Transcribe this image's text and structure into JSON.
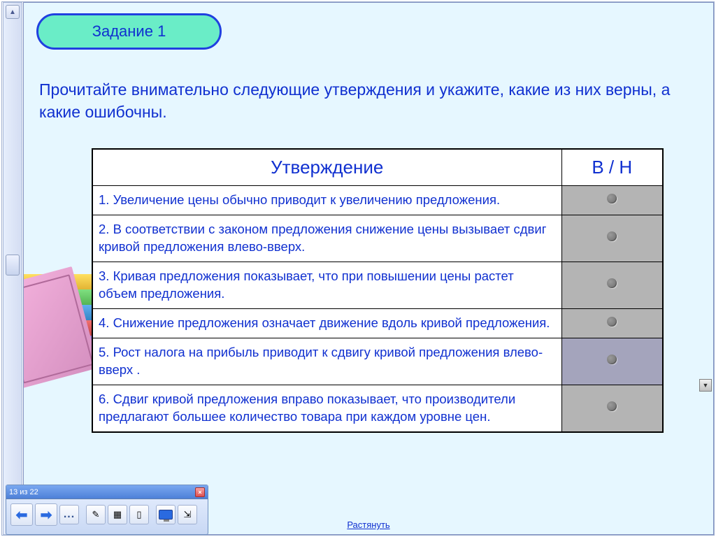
{
  "task": {
    "badge": "Задание 1",
    "instruction": "Прочитайте внимательно следующие утверждения и укажите, какие из них верны, а какие ошибочны."
  },
  "table": {
    "header_statement": "Утверждение",
    "header_vh": "В / Н",
    "rows": [
      {
        "text": "1. Увеличение цены обычно приводит к увеличению предложения."
      },
      {
        "text": "2. В соответствии с законом предложения снижение цены вызывает сдвиг кривой предложения влево-вверх."
      },
      {
        "text": "3. Кривая предложения показывает, что при повышении цены растет объем предложения."
      },
      {
        "text": "4. Снижение предложения означает движение вдоль кривой предложения."
      },
      {
        "text": "5. Рост налога на прибыль приводит к сдвигу кривой предложения влево-вверх ."
      },
      {
        "text": "6. Сдвиг кривой предложения вправо показывает, что производители предлагают большее количество товара при каждом уровне цен."
      }
    ]
  },
  "footer": {
    "stretch": "Растянуть"
  },
  "nav": {
    "counter": "13 из 22",
    "dots": "..."
  }
}
